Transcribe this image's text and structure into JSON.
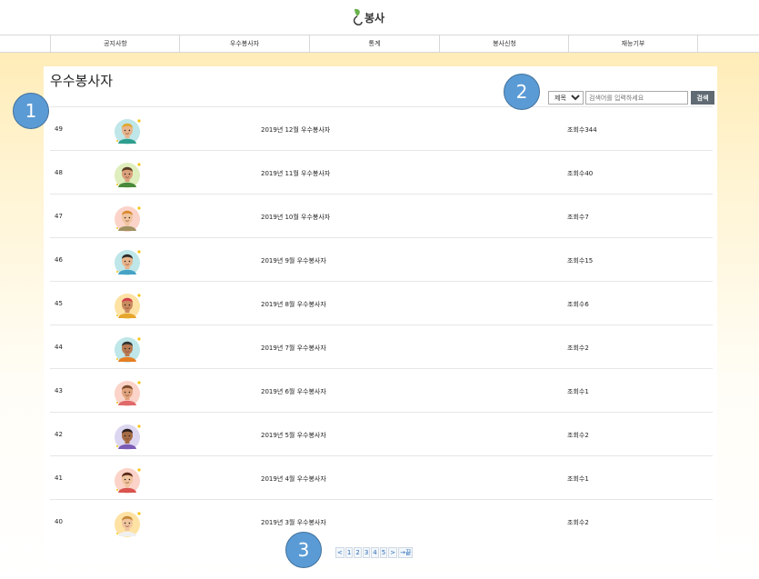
{
  "logo": {
    "text": "봉사"
  },
  "nav": {
    "items": [
      "공지사항",
      "우수봉사자",
      "통계",
      "봉사신청",
      "재능기부"
    ]
  },
  "page": {
    "title": "우수봉사자"
  },
  "search": {
    "select_value": "제목",
    "arrow": "▼",
    "placeholder": "검색어를 입력하세요",
    "button_label": "검색"
  },
  "rows": [
    {
      "num": "49",
      "title": "2019년 12월 우수봉사자",
      "views": "조회수344",
      "avatar": {
        "bg": "#bfe6e8",
        "skin": "#e8b58c",
        "hair": "#e0a830",
        "shirt": "#2f9e8f"
      }
    },
    {
      "num": "48",
      "title": "2019년 11월 우수봉사자",
      "views": "조회수40",
      "avatar": {
        "bg": "#dfeebd",
        "skin": "#d9a07a",
        "hair": "#5a3b23",
        "shirt": "#4a8a3a"
      }
    },
    {
      "num": "47",
      "title": "2019년 10월 우수봉사자",
      "views": "조회수7",
      "avatar": {
        "bg": "#fbd3c8",
        "skin": "#f0c49e",
        "hair": "#d9892e",
        "shirt": "#a09060"
      }
    },
    {
      "num": "46",
      "title": "2019년 9월 우수봉사자",
      "views": "조회수15",
      "avatar": {
        "bg": "#bfe6e8",
        "skin": "#e8b58c",
        "hair": "#2b2b2b",
        "shirt": "#46a3c6"
      }
    },
    {
      "num": "45",
      "title": "2019년 8월 우수봉사자",
      "views": "조회수6",
      "avatar": {
        "bg": "#fde2a4",
        "skin": "#c98a5e",
        "hair": "#d23c4b",
        "shirt": "#e6a52c"
      }
    },
    {
      "num": "44",
      "title": "2019년 7월 우수봉사자",
      "views": "조회수2",
      "avatar": {
        "bg": "#bfe6e8",
        "skin": "#b87a52",
        "hair": "#333333",
        "shirt": "#e67e22"
      }
    },
    {
      "num": "43",
      "title": "2019년 6월 우수봉사자",
      "views": "조회수1",
      "avatar": {
        "bg": "#fbd3c8",
        "skin": "#e0a27c",
        "hair": "#7a4a2a",
        "shirt": "#e06a6a"
      }
    },
    {
      "num": "42",
      "title": "2019년 5월 우수봉사자",
      "views": "조회수2",
      "avatar": {
        "bg": "#ddd6f0",
        "skin": "#a56b45",
        "hair": "#2b1e1a",
        "shirt": "#7b5bb5"
      }
    },
    {
      "num": "41",
      "title": "2019년 4월 우수봉사자",
      "views": "조회수1",
      "avatar": {
        "bg": "#fbd3c8",
        "skin": "#f0c49e",
        "hair": "#5a2a1a",
        "shirt": "#d9534f"
      }
    },
    {
      "num": "40",
      "title": "2019년 3월 우수봉사자",
      "views": "조회수2",
      "avatar": {
        "bg": "#fde2a4",
        "skin": "#f0c49e",
        "hair": "#c48a3a",
        "shirt": "#f0f0f0"
      }
    }
  ],
  "pagination": {
    "prev": "<",
    "pages": [
      "1",
      "2",
      "3",
      "4",
      "5"
    ],
    "next": ">",
    "last": "→끝"
  },
  "markers": [
    "1",
    "2",
    "3"
  ]
}
